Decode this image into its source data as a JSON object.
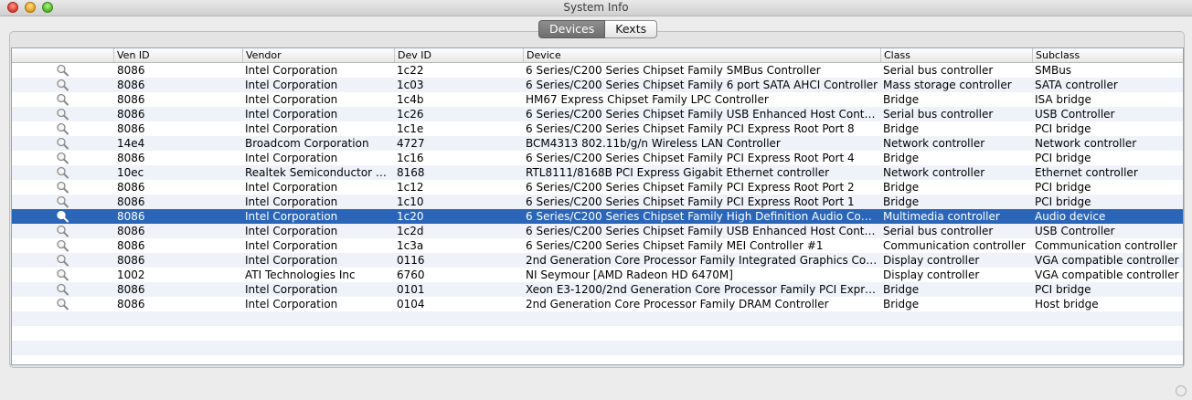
{
  "window": {
    "title": "System Info"
  },
  "tabs": [
    {
      "label": "Devices",
      "active": true
    },
    {
      "label": "Kexts",
      "active": false
    }
  ],
  "columns": [
    "",
    "Ven ID",
    "Vendor",
    "Dev ID",
    "Device",
    "Class",
    "Subclass"
  ],
  "icon": "magnifier-icon",
  "selected_index": 10,
  "rows": [
    {
      "ven": "8086",
      "vendor": "Intel Corporation",
      "dev": "1c22",
      "device": "6 Series/C200 Series Chipset Family SMBus Controller",
      "class": "Serial bus controller",
      "subclass": "SMBus"
    },
    {
      "ven": "8086",
      "vendor": "Intel Corporation",
      "dev": "1c03",
      "device": "6 Series/C200 Series Chipset Family 6 port SATA AHCI Controller",
      "class": "Mass storage controller",
      "subclass": "SATA controller"
    },
    {
      "ven": "8086",
      "vendor": "Intel Corporation",
      "dev": "1c4b",
      "device": "HM67 Express Chipset Family LPC Controller",
      "class": "Bridge",
      "subclass": "ISA bridge"
    },
    {
      "ven": "8086",
      "vendor": "Intel Corporation",
      "dev": "1c26",
      "device": "6 Series/C200 Series Chipset Family USB Enhanced Host Controll...",
      "class": "Serial bus controller",
      "subclass": "USB Controller"
    },
    {
      "ven": "8086",
      "vendor": "Intel Corporation",
      "dev": "1c1e",
      "device": "6 Series/C200 Series Chipset Family PCI Express Root Port 8",
      "class": "Bridge",
      "subclass": "PCI bridge"
    },
    {
      "ven": "14e4",
      "vendor": "Broadcom Corporation",
      "dev": "4727",
      "device": "BCM4313 802.11b/g/n Wireless LAN Controller",
      "class": "Network controller",
      "subclass": "Network controller"
    },
    {
      "ven": "8086",
      "vendor": "Intel Corporation",
      "dev": "1c16",
      "device": "6 Series/C200 Series Chipset Family PCI Express Root Port 4",
      "class": "Bridge",
      "subclass": "PCI bridge"
    },
    {
      "ven": "10ec",
      "vendor": "Realtek Semiconductor Co...",
      "dev": "8168",
      "device": "RTL8111/8168B PCI Express Gigabit Ethernet controller",
      "class": "Network controller",
      "subclass": "Ethernet controller"
    },
    {
      "ven": "8086",
      "vendor": "Intel Corporation",
      "dev": "1c12",
      "device": "6 Series/C200 Series Chipset Family PCI Express Root Port 2",
      "class": "Bridge",
      "subclass": "PCI bridge"
    },
    {
      "ven": "8086",
      "vendor": "Intel Corporation",
      "dev": "1c10",
      "device": "6 Series/C200 Series Chipset Family PCI Express Root Port 1",
      "class": "Bridge",
      "subclass": "PCI bridge"
    },
    {
      "ven": "8086",
      "vendor": "Intel Corporation",
      "dev": "1c20",
      "device": "6 Series/C200 Series Chipset Family High Definition Audio Contro...",
      "class": "Multimedia controller",
      "subclass": "Audio device"
    },
    {
      "ven": "8086",
      "vendor": "Intel Corporation",
      "dev": "1c2d",
      "device": "6 Series/C200 Series Chipset Family USB Enhanced Host Controll...",
      "class": "Serial bus controller",
      "subclass": "USB Controller"
    },
    {
      "ven": "8086",
      "vendor": "Intel Corporation",
      "dev": "1c3a",
      "device": "6 Series/C200 Series Chipset Family MEI Controller #1",
      "class": "Communication controller",
      "subclass": "Communication controller"
    },
    {
      "ven": "8086",
      "vendor": "Intel Corporation",
      "dev": "0116",
      "device": "2nd Generation Core Processor Family Integrated Graphics Contr...",
      "class": "Display controller",
      "subclass": "VGA compatible controller"
    },
    {
      "ven": "1002",
      "vendor": "ATI Technologies Inc",
      "dev": "6760",
      "device": "NI Seymour [AMD Radeon HD 6470M]",
      "class": "Display controller",
      "subclass": "VGA compatible controller"
    },
    {
      "ven": "8086",
      "vendor": "Intel Corporation",
      "dev": "0101",
      "device": "Xeon E3-1200/2nd Generation Core Processor Family PCI Expre...",
      "class": "Bridge",
      "subclass": "PCI bridge"
    },
    {
      "ven": "8086",
      "vendor": "Intel Corporation",
      "dev": "0104",
      "device": "2nd Generation Core Processor Family DRAM Controller",
      "class": "Bridge",
      "subclass": "Host bridge"
    }
  ]
}
